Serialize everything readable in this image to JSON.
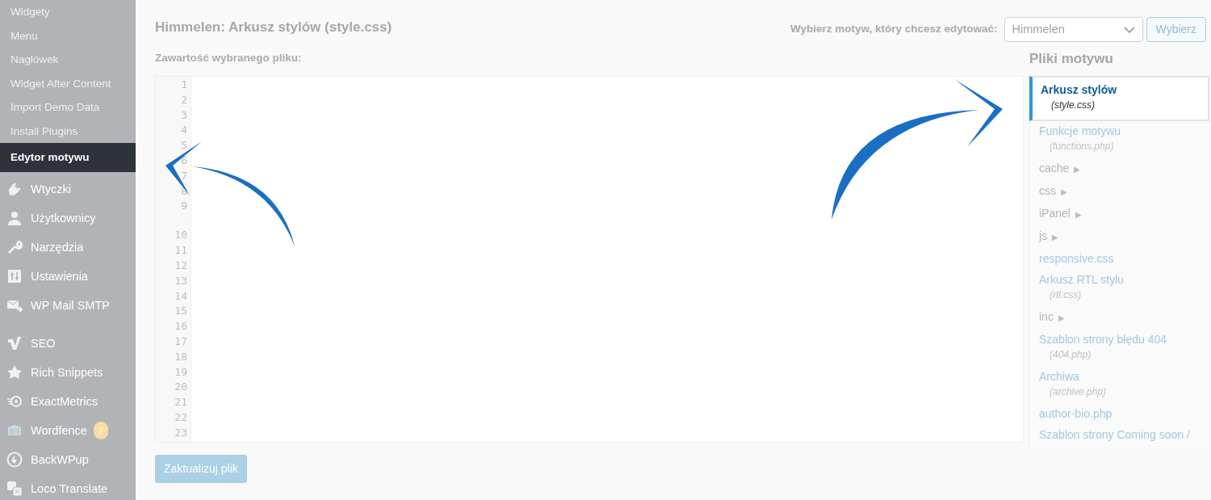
{
  "sidebar": {
    "items": [
      {
        "kind": "sub",
        "label": "Widgety",
        "selected": false
      },
      {
        "kind": "sub",
        "label": "Menu",
        "selected": false
      },
      {
        "kind": "sub",
        "label": "Nagłówek",
        "selected": false
      },
      {
        "kind": "sub",
        "label": "Widget After Content",
        "selected": false
      },
      {
        "kind": "sub",
        "label": "Import Demo Data",
        "selected": false
      },
      {
        "kind": "sub",
        "label": "Install Plugins",
        "selected": false
      },
      {
        "kind": "sub",
        "label": "Edytor motywu",
        "selected": true
      },
      {
        "kind": "menu",
        "label": "Wtyczki",
        "selected": false
      },
      {
        "kind": "menu",
        "label": "Użytkownicy",
        "selected": false
      },
      {
        "kind": "menu",
        "label": "Narzędzia",
        "selected": false
      },
      {
        "kind": "menu",
        "label": "Ustawienia",
        "selected": false
      },
      {
        "kind": "menu",
        "label": "WP Mail SMTP",
        "selected": false
      },
      {
        "kind": "separator"
      },
      {
        "kind": "menu",
        "label": "SEO",
        "selected": false
      },
      {
        "kind": "menu",
        "label": "Rich Snippets",
        "selected": false
      },
      {
        "kind": "menu",
        "label": "ExactMetrics",
        "selected": false
      },
      {
        "kind": "menu",
        "label": "Wordfence",
        "selected": false,
        "badge": "2"
      },
      {
        "kind": "menu",
        "label": "BackWPup",
        "selected": false
      },
      {
        "kind": "menu",
        "label": "Loco Translate",
        "selected": false
      }
    ]
  },
  "title": "Himmelen: Arkusz stylów (style.css)",
  "theme_picker": {
    "label": "Wybierz motyw, który chcesz edytować:",
    "value": "Himmelen",
    "button": "Wybierz"
  },
  "editor": {
    "label": "Zawartość wybranego pliku:",
    "lines": [
      {
        "n": "1",
        "wraps": false
      },
      {
        "n": "2",
        "wraps": false
      },
      {
        "n": "3",
        "wraps": false
      },
      {
        "n": "4",
        "wraps": false
      },
      {
        "n": "5",
        "wraps": false
      },
      {
        "n": "6",
        "wraps": false
      },
      {
        "n": "7",
        "wraps": false
      },
      {
        "n": "8",
        "wraps": false
      },
      {
        "n": "9",
        "wraps": true
      },
      {
        "n": "10",
        "wraps": false
      },
      {
        "n": "11",
        "wraps": false
      },
      {
        "n": "12",
        "wraps": false
      },
      {
        "n": "13",
        "wraps": false
      },
      {
        "n": "14",
        "wraps": false
      },
      {
        "n": "15",
        "wraps": false
      },
      {
        "n": "16",
        "wraps": false
      },
      {
        "n": "17",
        "wraps": false
      },
      {
        "n": "18",
        "wraps": false
      },
      {
        "n": "19",
        "wraps": false
      },
      {
        "n": "20",
        "wraps": false
      },
      {
        "n": "21",
        "wraps": false
      },
      {
        "n": "22",
        "wraps": false
      },
      {
        "n": "23",
        "wraps": false
      }
    ]
  },
  "update_button": "Zaktualizuj plik",
  "files": {
    "heading": "Pliki motywu",
    "items": [
      {
        "kind": "file",
        "label": "Arkusz stylów",
        "filename": "(style.css)",
        "selected": true
      },
      {
        "kind": "file",
        "label": "Funkcje motywu",
        "filename": "(functions.php)",
        "selected": false
      },
      {
        "kind": "folder",
        "label": "cache",
        "toggle": "▶",
        "selected": false
      },
      {
        "kind": "folder",
        "label": "css",
        "toggle": "▶",
        "selected": false
      },
      {
        "kind": "folder",
        "label": "iPanel",
        "toggle": "▶",
        "selected": false
      },
      {
        "kind": "folder",
        "label": "js",
        "toggle": "▶",
        "selected": false
      },
      {
        "kind": "file",
        "label": "responsive.css",
        "selected": false
      },
      {
        "kind": "file",
        "label": "Arkusz RTL stylu",
        "filename": "(rtl.css)",
        "selected": false
      },
      {
        "kind": "folder",
        "label": "inc",
        "toggle": "▶",
        "selected": false
      },
      {
        "kind": "file",
        "label": "Szablon strony błędu 404",
        "filename": "(404.php)",
        "selected": false
      },
      {
        "kind": "file",
        "label": "Archiwa",
        "filename": "(archive.php)",
        "selected": false
      },
      {
        "kind": "file",
        "label": "author-bio.php",
        "selected": false
      },
      {
        "kind": "file",
        "label": "Szablon strony Coming soon /",
        "selected": false
      }
    ]
  }
}
